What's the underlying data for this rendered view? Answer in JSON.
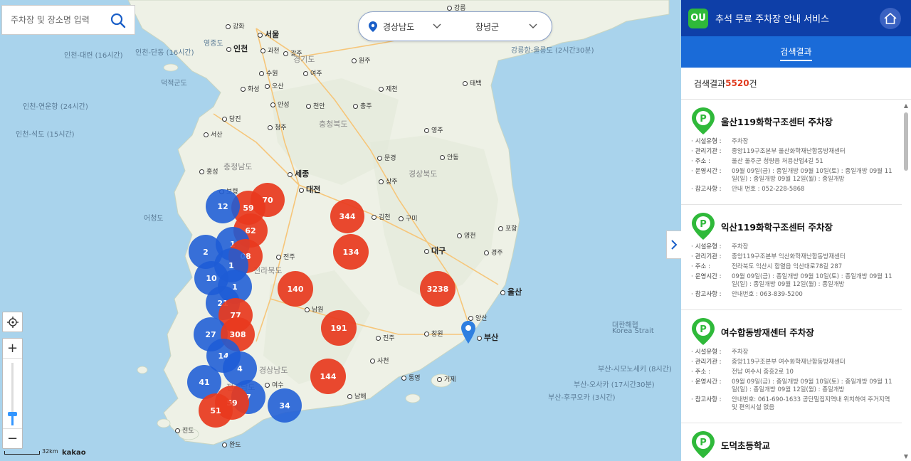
{
  "search": {
    "placeholder": "주차장 및 장소명 입력"
  },
  "region": {
    "province": "경상남도",
    "city": "창녕군"
  },
  "map": {
    "labels": [
      {
        "t": "강릉",
        "cls": "dot"
      },
      {
        "t": "강화",
        "cls": "dot"
      },
      {
        "t": "서울",
        "cls": "big dot"
      },
      {
        "t": "인천",
        "cls": "big dot"
      },
      {
        "t": "과천",
        "cls": "dot"
      },
      {
        "t": "광주",
        "cls": "dot"
      },
      {
        "t": "원주",
        "cls": "dot"
      },
      {
        "t": "수원",
        "cls": "dot"
      },
      {
        "t": "화성",
        "cls": "dot"
      },
      {
        "t": "오산",
        "cls": "dot"
      },
      {
        "t": "여주",
        "cls": "dot"
      },
      {
        "t": "안성",
        "cls": "dot"
      },
      {
        "t": "제천",
        "cls": "dot"
      },
      {
        "t": "태백",
        "cls": "dot"
      },
      {
        "t": "충주",
        "cls": "dot"
      },
      {
        "t": "천안",
        "cls": "dot"
      },
      {
        "t": "당진",
        "cls": "dot"
      },
      {
        "t": "서산",
        "cls": "dot"
      },
      {
        "t": "청주",
        "cls": "dot"
      },
      {
        "t": "영주",
        "cls": "dot"
      },
      {
        "t": "홍성",
        "cls": "dot"
      },
      {
        "t": "문경",
        "cls": "dot"
      },
      {
        "t": "안동",
        "cls": "dot"
      },
      {
        "t": "세종",
        "cls": "big dot"
      },
      {
        "t": "대전",
        "cls": "big dot"
      },
      {
        "t": "상주",
        "cls": "dot"
      },
      {
        "t": "보령",
        "cls": "dot"
      },
      {
        "t": "김천",
        "cls": "dot"
      },
      {
        "t": "구미",
        "cls": "dot"
      },
      {
        "t": "포항",
        "cls": "dot"
      },
      {
        "t": "영천",
        "cls": "dot"
      },
      {
        "t": "대구",
        "cls": "big dot"
      },
      {
        "t": "경주",
        "cls": "dot"
      },
      {
        "t": "전주",
        "cls": "dot"
      },
      {
        "t": "울산",
        "cls": "big dot"
      },
      {
        "t": "양산",
        "cls": "dot"
      },
      {
        "t": "부산",
        "cls": "big dot"
      },
      {
        "t": "진주",
        "cls": "dot"
      },
      {
        "t": "창원",
        "cls": "dot"
      },
      {
        "t": "사천",
        "cls": "dot"
      },
      {
        "t": "통영",
        "cls": "dot"
      },
      {
        "t": "거제",
        "cls": "dot"
      },
      {
        "t": "남원",
        "cls": "dot"
      },
      {
        "t": "남해",
        "cls": "dot"
      },
      {
        "t": "여수",
        "cls": "dot"
      },
      {
        "t": "진도",
        "cls": "dot"
      },
      {
        "t": "완도",
        "cls": "dot"
      },
      {
        "t": "충청북도",
        "cls": "region"
      },
      {
        "t": "충청남도",
        "cls": "region"
      },
      {
        "t": "경상북도",
        "cls": "region"
      },
      {
        "t": "경기도",
        "cls": "region"
      },
      {
        "t": "전라북도",
        "cls": "region"
      },
      {
        "t": "경상남도",
        "cls": "region"
      },
      {
        "t": "전라남도",
        "cls": "region"
      },
      {
        "t": "대한해협",
        "cls": "sea"
      },
      {
        "t": "Korea Strait",
        "cls": "sea"
      },
      {
        "t": "어청도",
        "cls": "sea"
      },
      {
        "t": "영종도",
        "cls": "sea"
      },
      {
        "t": "덕적군도",
        "cls": "sea"
      },
      {
        "t": "인천-대련 (16시간)",
        "cls": "sea"
      },
      {
        "t": "인천-단동 (16시간)",
        "cls": "sea"
      },
      {
        "t": "인천-연운항 (24시간)",
        "cls": "sea"
      },
      {
        "t": "인천-석도 (15시간)",
        "cls": "sea"
      },
      {
        "t": "강릉항-울릉도 (2시간30분)",
        "cls": "sea"
      },
      {
        "t": "부산-오사카 (17시간30분)",
        "cls": "sea"
      },
      {
        "t": "부산-후쿠오카 (3시간)",
        "cls": "sea"
      },
      {
        "t": "부산-시모노세키 (8시간)",
        "cls": "sea"
      }
    ],
    "clusters": [
      {
        "n": "70",
        "c": "red"
      },
      {
        "n": "59",
        "c": "red"
      },
      {
        "n": "12",
        "c": "blue"
      },
      {
        "n": "62",
        "c": "red"
      },
      {
        "n": "344",
        "c": "red"
      },
      {
        "n": "2",
        "c": "blue"
      },
      {
        "n": "1",
        "c": "blue"
      },
      {
        "n": "08",
        "c": "red"
      },
      {
        "n": "134",
        "c": "red"
      },
      {
        "n": "1",
        "c": "blue"
      },
      {
        "n": "10",
        "c": "blue"
      },
      {
        "n": "1",
        "c": "blue"
      },
      {
        "n": "140",
        "c": "red"
      },
      {
        "n": "3238",
        "c": "red"
      },
      {
        "n": "21",
        "c": "blue"
      },
      {
        "n": "77",
        "c": "red"
      },
      {
        "n": "191",
        "c": "red"
      },
      {
        "n": "27",
        "c": "blue"
      },
      {
        "n": "308",
        "c": "red"
      },
      {
        "n": "14",
        "c": "blue"
      },
      {
        "n": "4",
        "c": "blue"
      },
      {
        "n": "144",
        "c": "red"
      },
      {
        "n": "41",
        "c": "blue"
      },
      {
        "n": "7",
        "c": "blue"
      },
      {
        "n": "59",
        "c": "red"
      },
      {
        "n": "51",
        "c": "red"
      },
      {
        "n": "34",
        "c": "blue"
      }
    ],
    "scale_label": "32km",
    "attribution": "kakao"
  },
  "panel": {
    "logo_text": "OU",
    "title": "추석 무료 주차장 안내 서비스",
    "tab": "검색결과",
    "count_prefix": "검색결과 ",
    "count_value": "5520",
    "count_suffix": "건",
    "keys": {
      "type": "시설유형 :",
      "org": "관리기관 :",
      "addr": "주소 :",
      "hours": "운영시간 :",
      "note": "참고사항 :"
    },
    "results": [
      {
        "name": "울산119화학구조센터 주차장",
        "type": "주차장",
        "org": "중앙119구조본부 울산화학재난합동방재센터",
        "addr": "울산 울주군 청량읍 처용산업4길 51",
        "hours": "09월 09일(금) : 종일개방 09월 10일(토) : 종일개방 09월 11일(일) : 종일개방 09월 12일(월) : 종일개방",
        "note": "안내 번호 : 052-228-5868"
      },
      {
        "name": "익산119화학구조센터 주차장",
        "type": "주차장",
        "org": "중앙119구조본부 익산화학재난합동방재센터",
        "addr": "전라북도 익산시 함열읍 익산대로78길 287",
        "hours": "09월 09일(금) : 종일개방 09월 10일(토) : 종일개방 09월 11일(일) : 종일개방 09월 12일(월) : 종일개방",
        "note": "안내번호 : 063-839-5200"
      },
      {
        "name": "여수합동방재센터 주차장",
        "type": "주차장",
        "org": "중앙119구조본부 여수화학재난합동방재센터",
        "addr": "전남 여수시 중흥2로 10",
        "hours": "09월 09일(금) : 종일개방 09월 10일(토) : 종일개방 09월 11일(일) : 종일개방 09월 12일(월) : 종일개방",
        "note": "안내번호: 061-690-1633 공단밀집지역내 위치하여 주거지역 및 편의시설 없음"
      },
      {
        "name": "도덕초등학교",
        "type": "",
        "org": "",
        "addr": "",
        "hours": "",
        "note": ""
      }
    ]
  }
}
